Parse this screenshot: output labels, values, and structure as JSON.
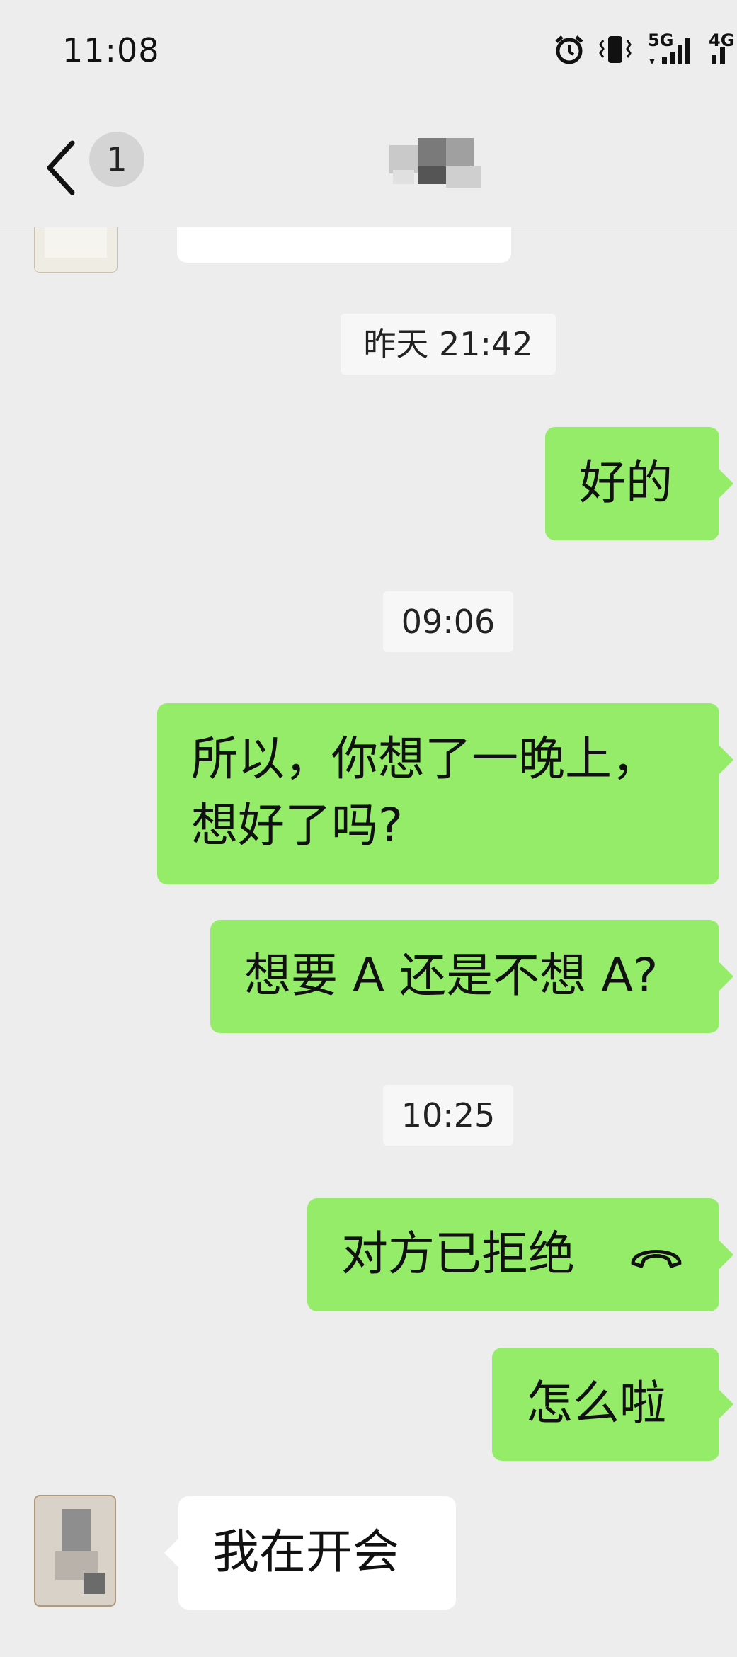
{
  "status_bar": {
    "time": "11:08",
    "network_5g": "5G",
    "network_4g": "4G"
  },
  "nav": {
    "unread_count": "1",
    "back_icon": "chevron-left-icon"
  },
  "messages": {
    "timestamp_1": "昨天 21:42",
    "sent_1": "好的",
    "timestamp_2": "09:06",
    "sent_2": "所以，你想了一晚上，\n想好了吗?",
    "sent_3": "想要 A 还是不想 A?",
    "timestamp_3": "10:25",
    "sent_call": "对方已拒绝",
    "call_icon": "hangup-phone-icon",
    "sent_4": "怎么啦",
    "received_1": "我在开会"
  },
  "colors": {
    "background": "#ededed",
    "sent_bubble": "#95ec69",
    "received_bubble": "#ffffff",
    "timestamp_bg": "#f7f7f7"
  }
}
